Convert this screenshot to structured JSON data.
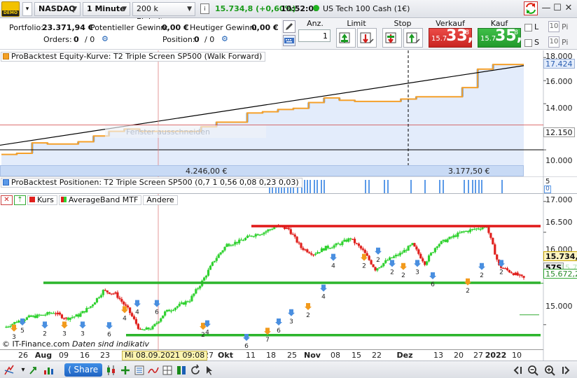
{
  "toolbar": {
    "instrument": "NASDAQ",
    "timeframe": "1 Minute",
    "units": "200 k Einheiten",
    "price": "15.734,8",
    "change": "(+0,60%)",
    "time": "10:52:03",
    "instrument_name": "US Tech 100 Cash (1€)",
    "logo_text": "DEMO"
  },
  "account": {
    "portfolio_label": "Portfolio:",
    "portfolio_value": "23.371,94 €",
    "potential_gain_label": "Potentieller Gewinn:",
    "potential_gain_value": "0,00 €",
    "today_gain_label": "Heutiger Gewinn:",
    "today_gain_value": "0,00 €",
    "orders_label": "Orders:",
    "orders_value": "0",
    "orders_value2": "/ 0",
    "position_label": "Position:",
    "position_value": "0",
    "position_value2": "/ 0"
  },
  "order": {
    "qty_label": "Anz.",
    "qty_value": "1",
    "limit_label": "Limit",
    "stop_label": "Stop",
    "sell_label": "Verkauf",
    "buy_label": "Kauf",
    "sell_small": "15.7",
    "sell_big": "33,",
    "sell_sup": "8",
    "buy_small": "15.7",
    "buy_big": "35,",
    "buy_sup": "8",
    "l_label": "L",
    "s_label": "S",
    "l_value": "10",
    "s_value": "10",
    "pts_label": "Pi"
  },
  "equity": {
    "title": "ProBacktest Equity-Kurve: T2 Triple Screen SP500 (Walk Forward)",
    "y_ticks": [
      "18.000",
      "16.000",
      "14.000",
      "12.000",
      "10.000"
    ],
    "current_tag": "17.424",
    "red_tag": "12.150",
    "label_left": "4.246,00 €",
    "label_right": "3.177,50 €",
    "tooltip_text": "Fenster ausschneiden",
    "colors": {
      "equity_line": "#f5a02a",
      "fill": "#e3ecfb",
      "blue_tick": "#4a90e2",
      "trend": "#000000"
    }
  },
  "positions": {
    "title": "ProBacktest Positionen: T2 Triple Screen SP500 (0,7 1 0,56 0,08 0,23 0,03)",
    "y_top": "5",
    "y_bottom": "0"
  },
  "price_chart": {
    "tags": [
      "Kurs",
      "AverageBand MTF",
      "Andere"
    ],
    "y_ticks": [
      "17.000",
      "16.500",
      "16.000",
      "15.500",
      "15.000"
    ],
    "price_tag": "15.734,8",
    "tag_57s": "57S",
    "tag_lower": "15.672,2",
    "tag_faded": "15.7",
    "copyright": "© IT-Finance.com",
    "disclaimer": "Daten sind indikativ",
    "cursor_date": "Mi 08.09.2021 09:08",
    "x_ticks": [
      {
        "t": "26",
        "bold": false
      },
      {
        "t": "Aug",
        "bold": true
      },
      {
        "t": "09",
        "bold": false
      },
      {
        "t": "16",
        "bold": false
      },
      {
        "t": "23",
        "bold": false
      },
      {
        "t": "27",
        "bold": false
      },
      {
        "t": "Okt",
        "bold": true
      },
      {
        "t": "11",
        "bold": false
      },
      {
        "t": "18",
        "bold": false
      },
      {
        "t": "25",
        "bold": false
      },
      {
        "t": "Nov",
        "bold": true
      },
      {
        "t": "08",
        "bold": false
      },
      {
        "t": "15",
        "bold": false
      },
      {
        "t": "22",
        "bold": false
      },
      {
        "t": "Dez",
        "bold": true
      },
      {
        "t": "13",
        "bold": false
      },
      {
        "t": "20",
        "bold": false
      },
      {
        "t": "27",
        "bold": false
      },
      {
        "t": "2022",
        "bold": true
      },
      {
        "t": "10",
        "bold": false
      }
    ],
    "annotations": [
      "3",
      "5",
      "2",
      "3",
      "3",
      "6",
      "4",
      "4",
      "6",
      "2",
      "4",
      "6",
      "7",
      "6",
      "3",
      "2",
      "4",
      "4",
      "2",
      "2",
      "2",
      "2",
      "3",
      "6",
      "2",
      "2",
      "2"
    ],
    "colors": {
      "up": "#2fd12f",
      "down": "#e0201d",
      "res": "#e01818",
      "sup": "#2bb52b"
    }
  },
  "chart_data": [
    {
      "type": "line",
      "title": "ProBacktest Equity-Kurve: T2 Triple Screen SP500 (Walk Forward)",
      "ylim": [
        8000,
        18500
      ],
      "series": [
        {
          "name": "",
          "values": [
            9600,
            9700,
            10600,
            10500,
            10500,
            10700,
            11200,
            11600,
            11800,
            11600,
            11600,
            11600,
            11600,
            12000,
            12400,
            12400,
            13200,
            13300,
            13500,
            13600,
            14100,
            14500,
            14300,
            14200,
            14200,
            14200,
            14400,
            14600,
            14600,
            14600,
            15400,
            17000,
            17400,
            17400,
            17400
          ]
        }
      ]
    },
    {
      "type": "line",
      "title": "",
      "ylim": [
        14600,
        17100
      ],
      "series": [
        {
          "name": "",
          "values": [
            14950,
            15050,
            15120,
            15150,
            15200,
            15100,
            15150,
            15300,
            15550,
            15500,
            15250,
            14900,
            14950,
            15200,
            15300,
            15400,
            15700,
            16050,
            16300,
            16350,
            16450,
            16500,
            16600,
            16550,
            16250,
            16150,
            16250,
            16300,
            16400,
            16200,
            15900,
            16050,
            16150,
            16300,
            16000,
            16300,
            16400,
            16500,
            16550,
            16600,
            15950,
            15850,
            15750
          ]
        }
      ]
    }
  ]
}
